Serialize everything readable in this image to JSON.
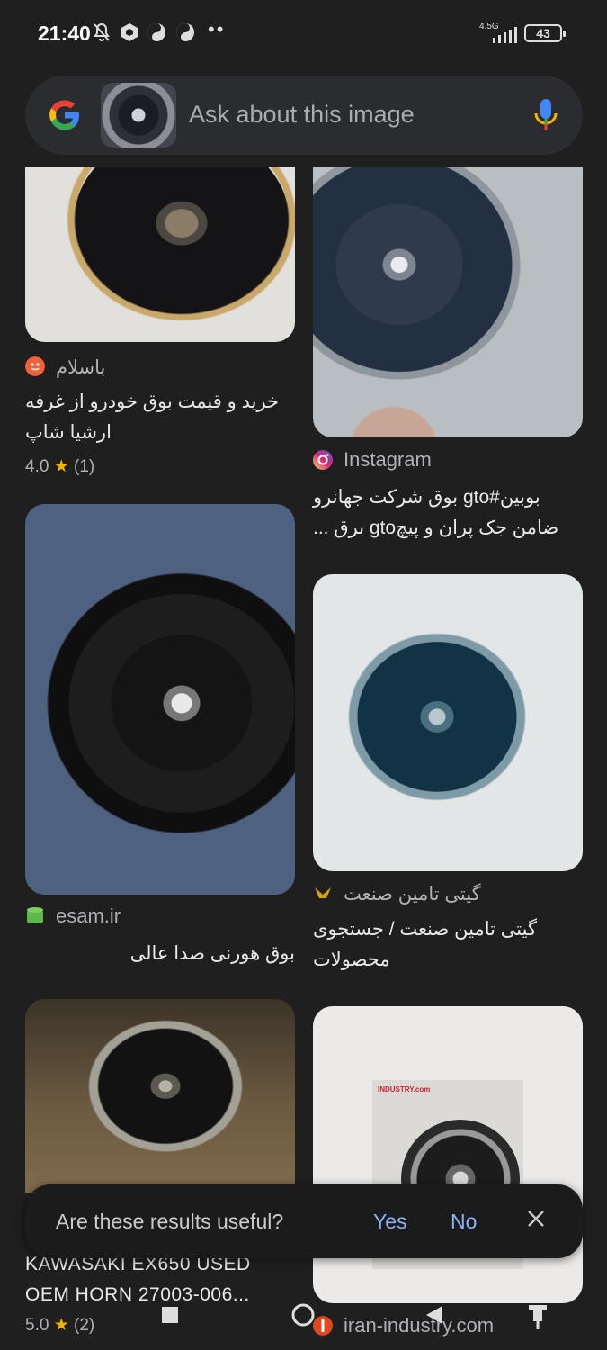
{
  "status_bar": {
    "time": "21:40",
    "network": "4.5G",
    "battery": "43",
    "more": "••"
  },
  "search": {
    "placeholder": "Ask about this image"
  },
  "results": [
    {
      "source": "باسلام",
      "title": "خرید و قیمت بوق خودرو از غرفه ارشیا شاپ",
      "rating": "4.0",
      "reviews": "(1)"
    },
    {
      "source": "Instagram",
      "title": "بوبین#gto بوق شرکت جهانرو ضامن جک پران و پیچgto برق ..."
    },
    {
      "source": "esam.ir",
      "title": "بوق هورنی صدا عالی"
    },
    {
      "source": "گیتی تامین صنعت",
      "title": "گیتی تامین صنعت / جستجوی محصولات"
    },
    {
      "title": "KAWASAKI EX650 USED OEM HORN 27003-006...",
      "rating": "5.0",
      "reviews": "(2)"
    },
    {
      "source": "iran-industry.com",
      "image_text": "INDUSTRY.com"
    }
  ],
  "feedback": {
    "question": "Are these results useful?",
    "yes": "Yes",
    "no": "No"
  },
  "colors": {
    "background": "#1f1f1f",
    "accent": "#8ab4f8",
    "star": "#f0b400"
  }
}
